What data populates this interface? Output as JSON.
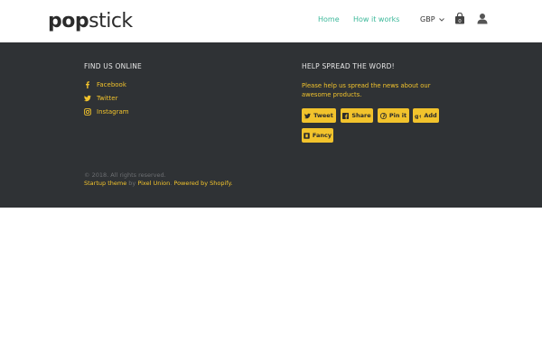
{
  "header": {
    "logo_bold": "pop",
    "logo_light": "stick",
    "nav": [
      {
        "label": "Home"
      },
      {
        "label": "How it works"
      }
    ],
    "currency": "GBP",
    "cart_count": "0"
  },
  "footer": {
    "find_us_title": "FIND US ONLINE",
    "social": [
      {
        "label": "Facebook",
        "icon": "facebook-icon"
      },
      {
        "label": "Twitter",
        "icon": "twitter-icon"
      },
      {
        "label": "Instagram",
        "icon": "instagram-icon"
      }
    ],
    "spread_title": "HELP SPREAD THE WORD!",
    "spread_text": "Please help us spread the news about our awesome products.",
    "share_buttons": [
      {
        "label": "Tweet",
        "icon": "twitter-icon"
      },
      {
        "label": "Share",
        "icon": "facebook-icon"
      },
      {
        "label": "Pin it",
        "icon": "pinterest-icon"
      },
      {
        "label": "Add",
        "icon": "google-plus-icon"
      },
      {
        "label": "Fancy",
        "icon": "fancy-icon"
      }
    ],
    "copyright": "© 2018. All rights reserved.",
    "theme_link": "Startup theme",
    "by_text": "by",
    "author_link": "Pixel Union",
    "powered_link": "Powered by Shopify."
  },
  "colors": {
    "accent": "#f2c32c",
    "nav_link": "#3cb89a",
    "footer_bg": "#2f3235"
  }
}
